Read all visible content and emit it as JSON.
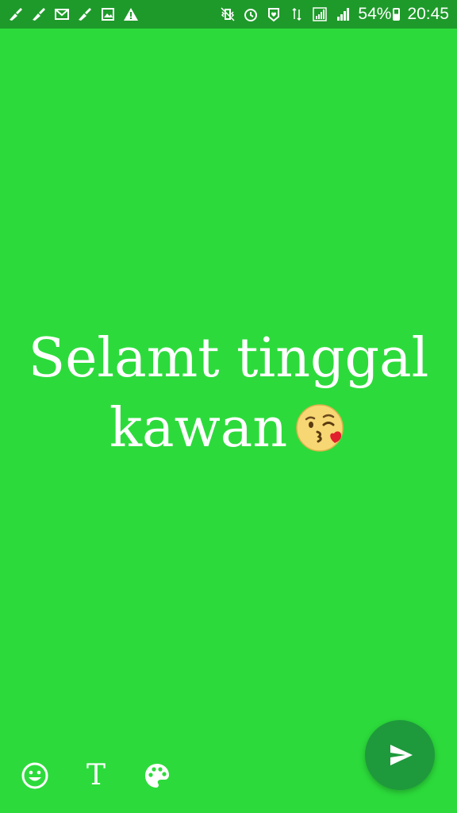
{
  "status_bar": {
    "battery_percent_text": "54%",
    "time": "20:45",
    "left_icons": [
      "broom-icon",
      "broom-icon",
      "mail-icon",
      "broom-icon",
      "image-icon",
      "warning-icon"
    ],
    "right_icons": [
      "vibrate-icon",
      "alarm-icon",
      "shield-icon",
      "data-arrows-icon",
      "signal-icon",
      "signal-icon",
      "battery-icon"
    ],
    "background_color": "#1e9a2a"
  },
  "composer": {
    "background_color": "#2cdb3b",
    "line1": "Selamt tinggal",
    "line2": "kawan",
    "emoji": "face-blowing-a-kiss"
  },
  "toolbar": {
    "emoji_button_icon": "smiley-icon",
    "text_button_label": "T",
    "palette_button_icon": "palette-icon"
  },
  "send_button": {
    "icon": "send-icon",
    "color": "#1e9a3c"
  }
}
